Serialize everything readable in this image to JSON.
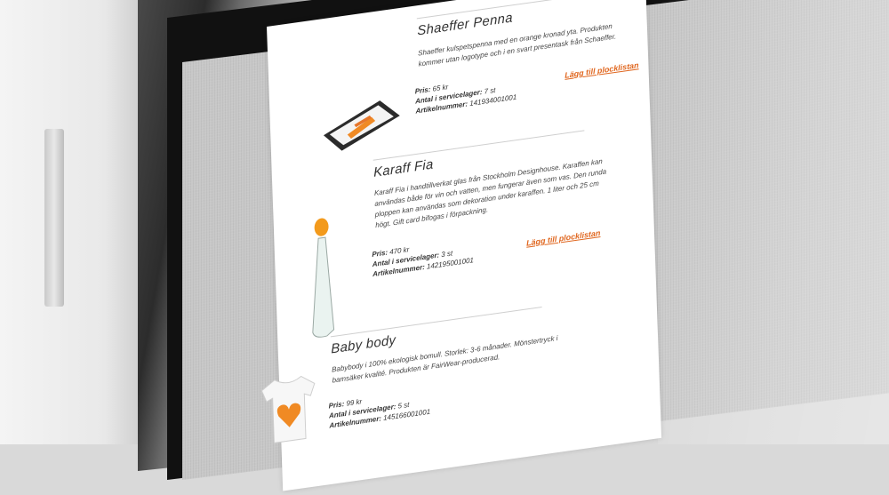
{
  "products": [
    {
      "title": "Shaeffer Penna",
      "description": "Shaeffer kulspetspenna med en orange kronad yta. Produkten kommer utan logotype och i en svart presentask från Schaeffer.",
      "price_label": "Pris:",
      "price": "65 kr",
      "stock_label": "Antal i servicelager:",
      "stock": "7 st",
      "article_label": "Artikelnummer:",
      "article": "141934001001",
      "link": "Lägg till plocklistan",
      "image_icon": "pen-in-box-icon"
    },
    {
      "title": "Karaff Fia",
      "description": "Karaff Fia i handtillverkat glas från Stockholm Designhouse. Karaffen kan användas både för vin och vatten, men fungerar även som vas. Den runda ploppen kan användas som dekoration under karaffen. 1 liter och 25 cm högt. Gift card bifogas i förpackning.",
      "price_label": "Pris:",
      "price": "470 kr",
      "stock_label": "Antal i servicelager:",
      "stock": "3 st",
      "article_label": "Artikelnummer:",
      "article": "142195001001",
      "link": "Lägg till plocklistan",
      "image_icon": "glass-carafe-icon"
    },
    {
      "title": "Baby body",
      "description": "Babybody i 100% ekologisk bomull. Storlek: 3-6 månader. Mönstertryck i bamsäker kvalité. Produkten är FairWear-producerad.",
      "price_label": "Pris:",
      "price": "99 kr",
      "stock_label": "Antal i servicelager:",
      "stock": "5 st",
      "article_label": "Artikelnummer:",
      "article": "145166001001",
      "image_icon": "baby-bodysuit-icon"
    }
  ],
  "colors": {
    "accent": "#e0661e",
    "bezel": "#111111",
    "page": "#ffffff"
  }
}
